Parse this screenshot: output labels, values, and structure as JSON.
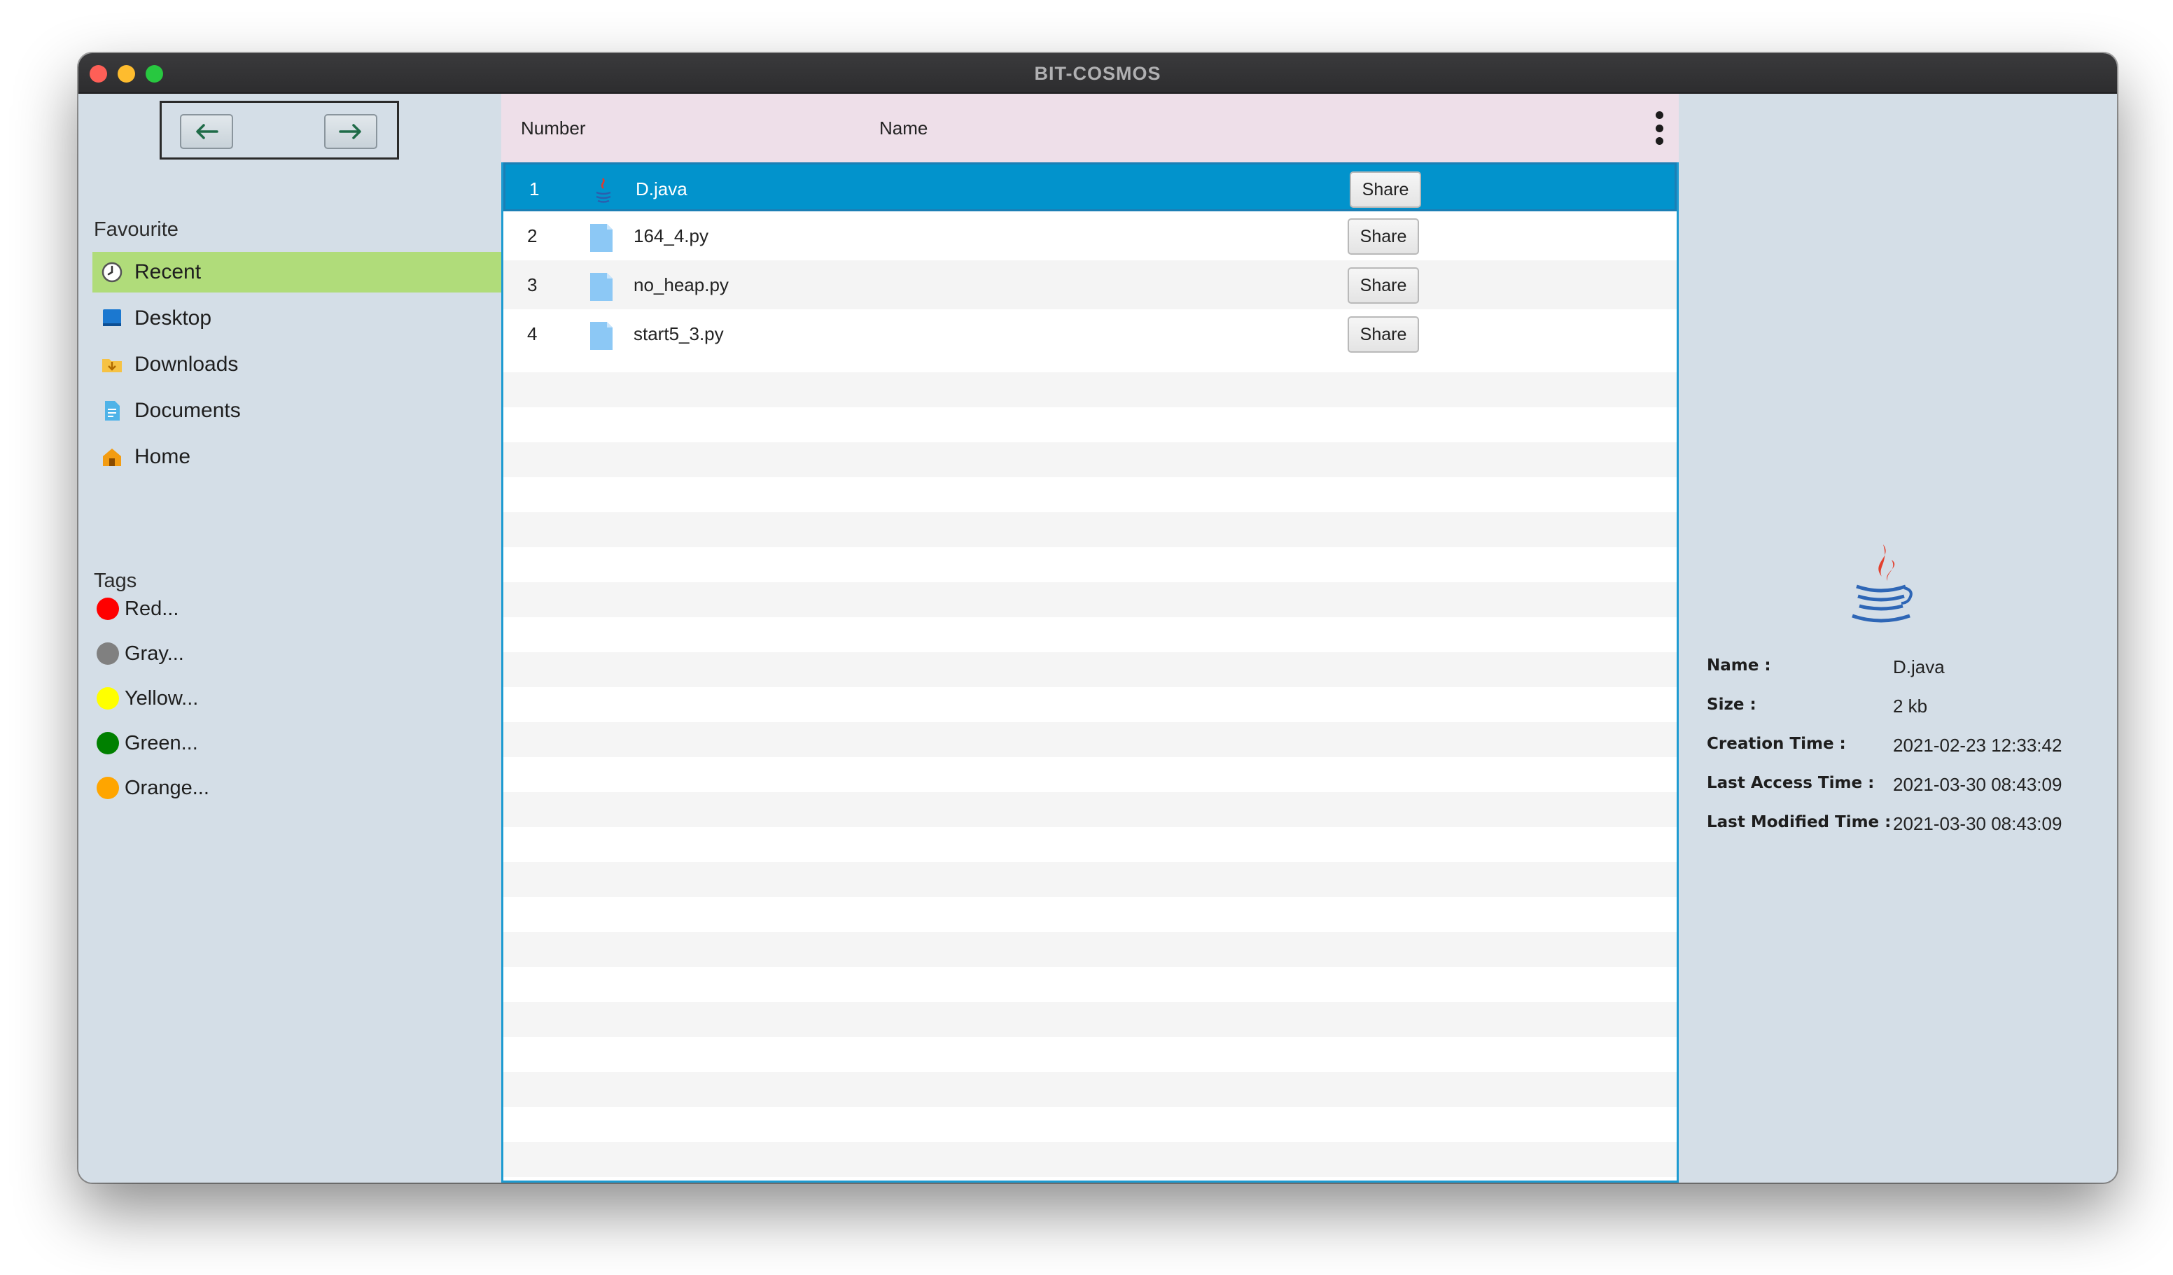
{
  "window": {
    "title": "BIT-COSMOS"
  },
  "sidebar": {
    "favourite_label": "Favourite",
    "favourites": [
      {
        "label": "Recent",
        "icon": "clock-icon",
        "selected": true
      },
      {
        "label": "Desktop",
        "icon": "desktop-icon",
        "selected": false
      },
      {
        "label": "Downloads",
        "icon": "downloads-folder-icon",
        "selected": false
      },
      {
        "label": "Documents",
        "icon": "document-icon",
        "selected": false
      },
      {
        "label": "Home",
        "icon": "home-icon",
        "selected": false
      }
    ],
    "tags_label": "Tags",
    "tags": [
      {
        "label": "Red...",
        "color": "#ff0000"
      },
      {
        "label": "Gray...",
        "color": "#808080"
      },
      {
        "label": "Yellow...",
        "color": "#ffff00"
      },
      {
        "label": "Green...",
        "color": "#008000"
      },
      {
        "label": "Orange...",
        "color": "#ffa500"
      }
    ]
  },
  "table": {
    "columns": {
      "number": "Number",
      "name": "Name"
    },
    "rows": [
      {
        "number": "1",
        "name": "D.java",
        "icon": "java-file-icon",
        "share": "Share",
        "selected": true
      },
      {
        "number": "2",
        "name": "164_4.py",
        "icon": "file-icon",
        "share": "Share",
        "selected": false
      },
      {
        "number": "3",
        "name": "no_heap.py",
        "icon": "file-icon",
        "share": "Share",
        "selected": false
      },
      {
        "number": "4",
        "name": "start5_3.py",
        "icon": "file-icon",
        "share": "Share",
        "selected": false
      }
    ]
  },
  "details": {
    "icon": "java-logo-icon",
    "name_label": "Name :",
    "name_value": "D.java",
    "size_label": "Size :",
    "size_value": "2 kb",
    "creation_label": "Creation Time :",
    "creation_value": "2021-02-23 12:33:42",
    "access_label": "Last Access Time :",
    "access_value": "2021-03-30 08:43:09",
    "modified_label": "Last Modified Time :",
    "modified_value": "2021-03-30 08:43:09"
  },
  "colors": {
    "selected_row": "#0293cc",
    "selected_sidebar": "#b0dc7a",
    "header_bg": "#eedfe9",
    "panel_bg": "#d4dee7"
  }
}
